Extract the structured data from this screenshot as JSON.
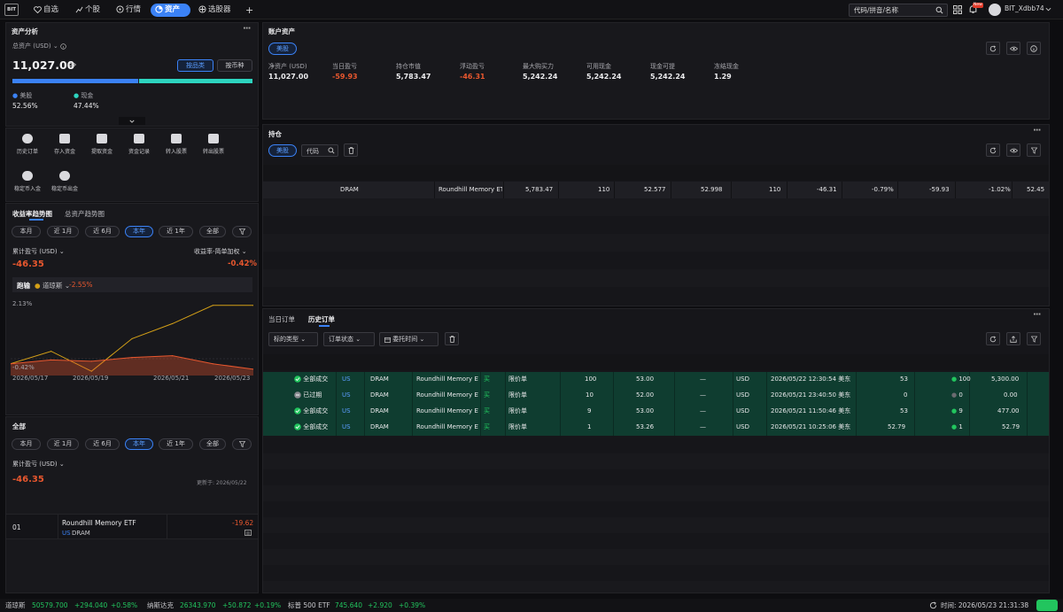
{
  "topbar": {
    "logo": "BIT",
    "nav": [
      {
        "label": "自选",
        "icon": "heart-icon"
      },
      {
        "label": "个股",
        "icon": "stock-chart-icon"
      },
      {
        "label": "行情",
        "icon": "market-icon"
      },
      {
        "label": "资产",
        "icon": "asset-pie-icon",
        "active": true
      },
      {
        "label": "选股器",
        "icon": "screener-icon"
      }
    ],
    "add": "+",
    "search_placeholder": "代码/拼音/名称",
    "badge": "New",
    "username": "BIT_Xdbb74"
  },
  "asset_analysis": {
    "title": "资产分析",
    "total_label": "总资产 (USD)",
    "total_value": "11,027.00",
    "by_category": "按品类",
    "by_currency": "按币种",
    "split": [
      {
        "label": "美股",
        "pct": "52.56%",
        "share": 0.5256,
        "color": "#3b82f6"
      },
      {
        "label": "现金",
        "pct": "47.44%",
        "share": 0.4744,
        "color": "#2dd4bf"
      }
    ],
    "quick_actions": [
      "历史订单",
      "存入资金",
      "提取资金",
      "资金记录",
      "转入股票",
      "转出股票",
      "稳定币入金",
      "稳定币出金"
    ]
  },
  "trend": {
    "tabs": [
      "收益率趋势图",
      "总资产趋势图"
    ],
    "ranges": [
      "本月",
      "近 1月",
      "近 6月",
      "本年",
      "近 1年",
      "全部"
    ],
    "selected_range": "本年",
    "pnl_label": "累计盈亏 (USD)",
    "pnl_value": "-46.35",
    "rate_label": "收益率-简单加权",
    "rate_value": "-0.42%",
    "benchmark_label": "跑输",
    "benchmark_name": "道琼斯",
    "benchmark_value": "-2.55%",
    "y_top": "2.13%",
    "y_bottom": "-0.42%",
    "x_labels": [
      "2026/05/17",
      "2026/05/19",
      "2026/05/21",
      "2026/05/23"
    ]
  },
  "chart_data": {
    "type": "line",
    "x": [
      "2026/05/17",
      "2026/05/18",
      "2026/05/19",
      "2026/05/20",
      "2026/05/21",
      "2026/05/22",
      "2026/05/23"
    ],
    "series": [
      {
        "name": "道琼斯",
        "values": [
          -0.2,
          0.3,
          -0.5,
          0.8,
          1.4,
          2.13,
          2.13
        ],
        "color": "#d4a017"
      },
      {
        "values": [
          -0.2,
          -0.05,
          -0.1,
          0.05,
          0.12,
          -0.2,
          -0.42
        ],
        "color": "#e8572e"
      }
    ],
    "ylim": [
      -0.6,
      2.3
    ]
  },
  "all_section": {
    "title": "全部",
    "ranges": [
      "本月",
      "近 1月",
      "近 6月",
      "本年",
      "近 1年",
      "全部"
    ],
    "selected_range": "本年",
    "pnl_label": "累计盈亏 (USD)",
    "pnl_value": "-46.35",
    "updated": "更新于: 2026/05/22",
    "row": {
      "rank": "01",
      "name": "Roundhill Memory ETF",
      "market": "US",
      "code": "DRAM",
      "value": "-19.62"
    }
  },
  "account": {
    "title": "账户资产",
    "market_tab": "美股",
    "metrics": [
      {
        "label": "净资产 (USD)",
        "value": "11,027.00"
      },
      {
        "label": "当日盈亏",
        "value": "-59.93",
        "neg": true
      },
      {
        "label": "持仓市值",
        "value": "5,783.47"
      },
      {
        "label": "浮动盈亏",
        "value": "-46.31",
        "neg": true
      },
      {
        "label": "最大购买力",
        "value": "5,242.24"
      },
      {
        "label": "可用现金",
        "value": "5,242.24"
      },
      {
        "label": "现金可提",
        "value": "5,242.24"
      },
      {
        "label": "冻结现金",
        "value": "1.29"
      }
    ]
  },
  "holdings": {
    "title": "持仓",
    "market_tab": "美股",
    "code_filter": "代码",
    "row": [
      "DRAM",
      "Roundhill Memory ET",
      "5,783.47",
      "110",
      "52.577",
      "52.998",
      "110",
      "-46.31",
      "-0.79%",
      "-59.93",
      "-1.02%",
      "52.45"
    ]
  },
  "orders": {
    "tabs": [
      "当日订单",
      "历史订单"
    ],
    "active_tab": "历史订单",
    "filters": [
      "标的类型",
      "订单状态",
      "委托时间"
    ],
    "rows": [
      {
        "status": "全部成交",
        "filled": true,
        "market": "US",
        "code": "DRAM",
        "name": "Roundhill Memory ET",
        "side": "买",
        "type": "限价单",
        "qty": "100",
        "price": "53.00",
        "dash": "—",
        "ccy": "USD",
        "time": "2026/05/22 12:30:54 美东",
        "avg": "53",
        "fqty": "100",
        "amount": "5,300.00"
      },
      {
        "status": "已过期",
        "filled": false,
        "market": "US",
        "code": "DRAM",
        "name": "Roundhill Memory ET",
        "side": "买",
        "type": "限价单",
        "qty": "10",
        "price": "52.00",
        "dash": "—",
        "ccy": "USD",
        "time": "2026/05/21 23:40:50 美东",
        "avg": "0",
        "fqty": "0",
        "amount": "0.00"
      },
      {
        "status": "全部成交",
        "filled": true,
        "market": "US",
        "code": "DRAM",
        "name": "Roundhill Memory ET",
        "side": "买",
        "type": "限价单",
        "qty": "9",
        "price": "53.00",
        "dash": "—",
        "ccy": "USD",
        "time": "2026/05/21 11:50:46 美东",
        "avg": "53",
        "fqty": "9",
        "amount": "477.00"
      },
      {
        "status": "全部成交",
        "filled": true,
        "market": "US",
        "code": "DRAM",
        "name": "Roundhill Memory ET",
        "side": "买",
        "type": "限价单",
        "qty": "1",
        "price": "53.26",
        "dash": "—",
        "ccy": "USD",
        "time": "2026/05/21 10:25:06 美东",
        "avg": "52.79",
        "fqty": "1",
        "amount": "52.79"
      }
    ]
  },
  "ticker": [
    {
      "name": "道琼斯",
      "price": "50579.700",
      "chg": "+294.040",
      "pct": "+0.58%"
    },
    {
      "name": "纳斯达克",
      "price": "26343.970",
      "chg": "+50.872",
      "pct": "+0.19%"
    },
    {
      "name": "标普 500 ETF",
      "price": "745.640",
      "chg": "+2.920",
      "pct": "+0.39%"
    }
  ],
  "clock": "时间: 2026/05/23 21:31:38"
}
